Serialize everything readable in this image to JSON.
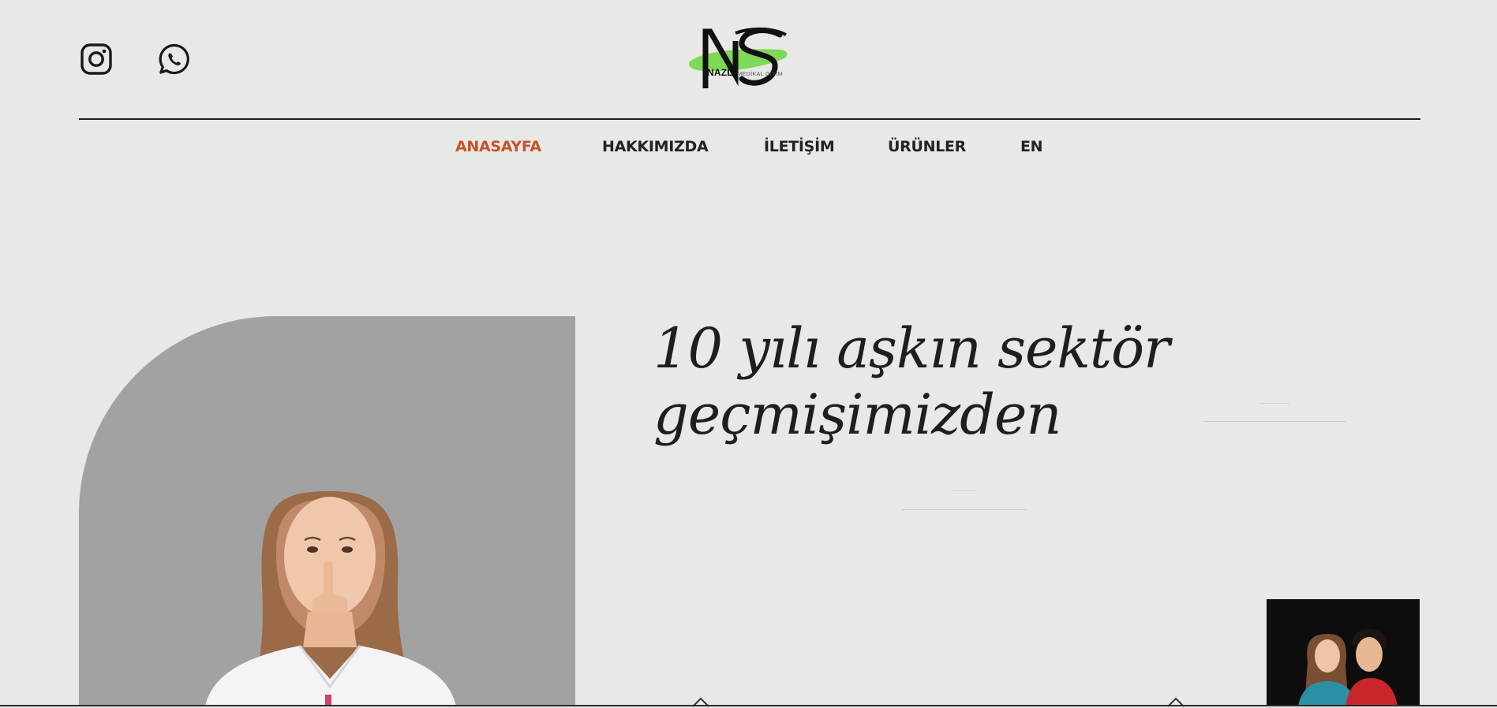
{
  "header": {
    "social": [
      {
        "name": "instagram",
        "icon": "instagram-icon"
      },
      {
        "name": "whatsapp",
        "icon": "whatsapp-icon"
      }
    ],
    "logo": {
      "word": "NAZLI",
      "sub": "MEDİKAL GİYİM",
      "accent_color": "#7ed957"
    }
  },
  "nav": {
    "items": [
      {
        "label": "ANASAYFA",
        "active": true
      },
      {
        "label": "HAKKIMIZDA",
        "active": false
      },
      {
        "label": "İLETİŞİM",
        "active": false
      },
      {
        "label": "ÜRÜNLER",
        "active": false
      },
      {
        "label": "EN",
        "active": false
      }
    ],
    "active_color": "#c8532a"
  },
  "hero": {
    "headline_line1": "10 yılı aşkın sektör",
    "headline_line2": "geçmişimizden"
  }
}
